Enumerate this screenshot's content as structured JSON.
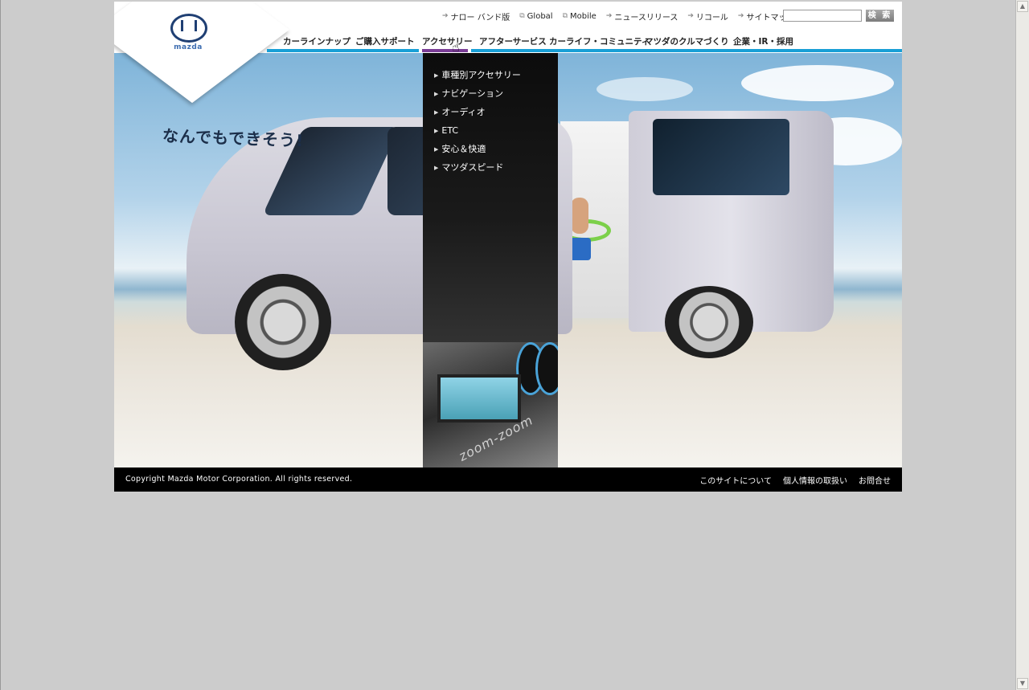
{
  "utility_nav": [
    {
      "label": "ナロー バンド版",
      "icon": "arrow-right-icon"
    },
    {
      "label": "Global",
      "icon": "external-window-icon"
    },
    {
      "label": "Mobile",
      "icon": "external-window-icon"
    },
    {
      "label": "ニュースリリース",
      "icon": "arrow-right-icon"
    },
    {
      "label": "リコール",
      "icon": "arrow-right-icon"
    },
    {
      "label": "サイトマップ",
      "icon": "arrow-right-icon"
    }
  ],
  "search": {
    "value": "",
    "button_label": "検 索"
  },
  "logo": {
    "text": "mazda"
  },
  "global_nav": [
    {
      "label": "カーラインナップ"
    },
    {
      "label": "ご購入サポート"
    },
    {
      "label": "アクセサリー"
    },
    {
      "label": "アフターサービス"
    },
    {
      "label": "カーライフ・コミュニティ"
    },
    {
      "label": "マツダのクルマづくり"
    },
    {
      "label": "企業・IR・採用"
    }
  ],
  "active_nav": "アクセサリー",
  "dropdown": [
    {
      "label": "車種別アクセサリー"
    },
    {
      "label": "ナビゲーション"
    },
    {
      "label": "オーディオ"
    },
    {
      "label": "ETC"
    },
    {
      "label": "安心＆快適"
    },
    {
      "label": "マツダスピード"
    }
  ],
  "hero": {
    "tagline": "なんでもできそう!",
    "watermark": "zoom-zoom"
  },
  "footer": {
    "copyright": "Copyright Mazda Motor Corporation. All rights reserved.",
    "links": [
      {
        "label": "このサイトについて"
      },
      {
        "label": "個人情報の取扱い"
      },
      {
        "label": "お問合せ"
      }
    ]
  },
  "colors": {
    "nav_bar": "#189fd6",
    "active": "#7a3d96",
    "page_bg": "#cccccc"
  }
}
